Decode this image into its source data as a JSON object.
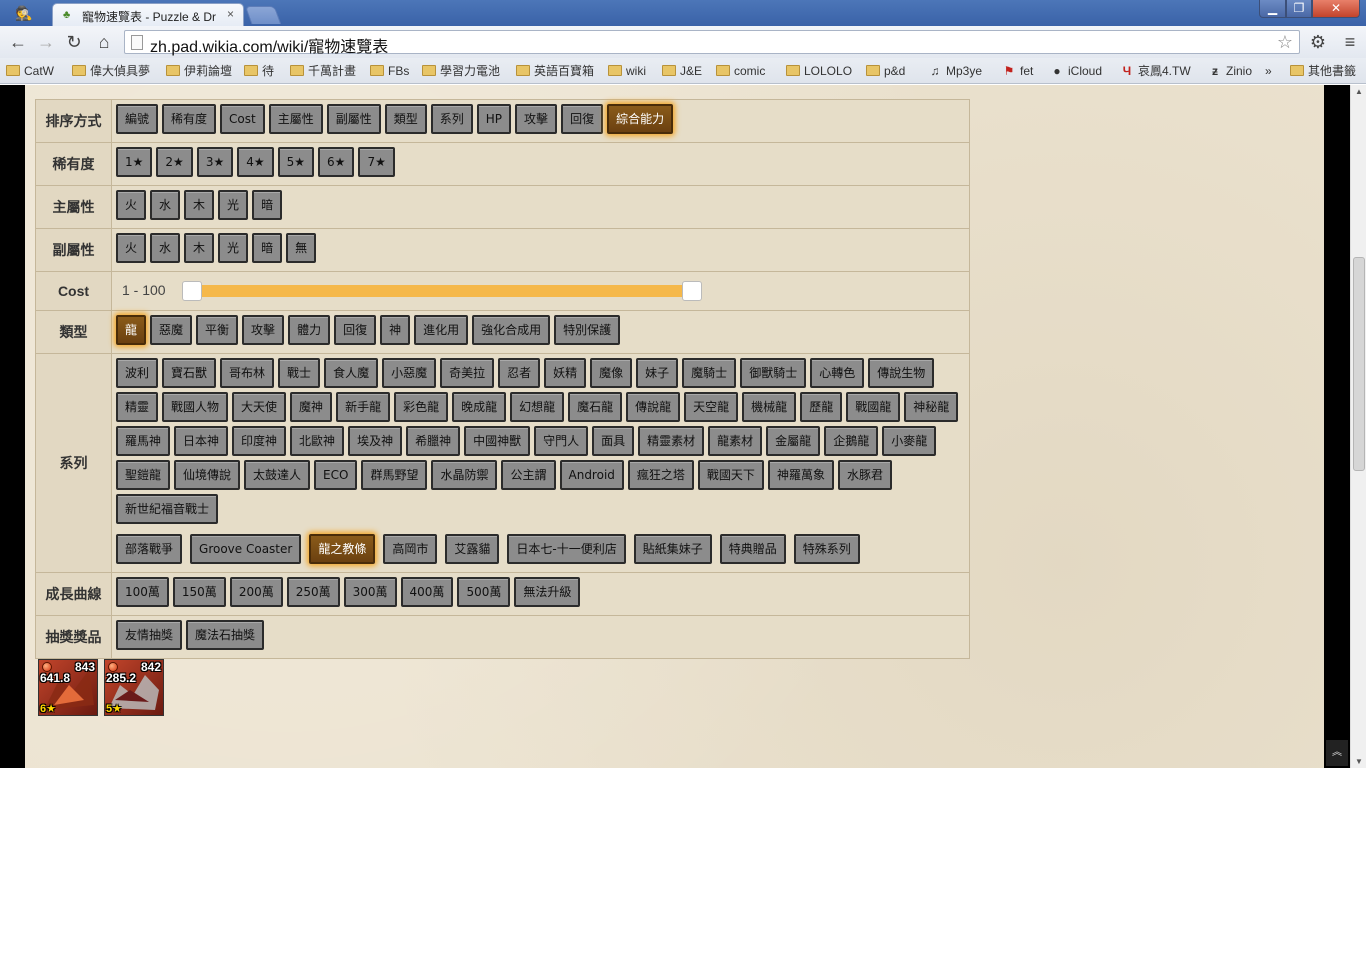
{
  "browser": {
    "tab_title": "寵物速覽表 - Puzzle & Dr",
    "tab_close": "×",
    "url_host": "zh.pad.wikia.com/wiki/寵物速覽表",
    "star": "☆"
  },
  "bookmarks": [
    {
      "label": "CatW",
      "icon": "folder-icon"
    },
    {
      "label": "偉大偵具夢",
      "icon": "folder-icon"
    },
    {
      "label": "伊莉論壇",
      "icon": "folder-icon"
    },
    {
      "label": "待",
      "icon": "folder-icon"
    },
    {
      "label": "千萬計畫",
      "icon": "folder-icon"
    },
    {
      "label": "FBs",
      "icon": "folder-icon"
    },
    {
      "label": "學習力電池",
      "icon": "folder-icon"
    },
    {
      "label": "英語百寶箱",
      "icon": "folder-icon"
    },
    {
      "label": "wiki",
      "icon": "folder-icon"
    },
    {
      "label": "J&E",
      "icon": "folder-icon"
    },
    {
      "label": "comic",
      "icon": "folder-icon"
    },
    {
      "label": "LOLOLO",
      "icon": "folder-icon"
    },
    {
      "label": "p&d",
      "icon": "folder-icon"
    },
    {
      "label": "Mp3ye",
      "icon": "music-icon"
    },
    {
      "label": "fet",
      "icon": "flag-icon"
    },
    {
      "label": "iCloud",
      "icon": "apple-icon"
    },
    {
      "label": "哀鳳4.TW",
      "icon": "logo-icon"
    },
    {
      "label": "Zinio",
      "icon": "zinio-icon"
    },
    {
      "label": "»",
      "icon": "more-icon"
    },
    {
      "label": "其他書籤",
      "icon": "folder-icon"
    }
  ],
  "filters": {
    "sort": {
      "label": "排序方式",
      "options": [
        "編號",
        "稀有度",
        "Cost",
        "主屬性",
        "副屬性",
        "類型",
        "系列",
        "HP",
        "攻擊",
        "回復",
        "綜合能力"
      ],
      "selected": "綜合能力"
    },
    "rarity": {
      "label": "稀有度",
      "options": [
        "1★",
        "2★",
        "3★",
        "4★",
        "5★",
        "6★",
        "7★"
      ]
    },
    "main_attr": {
      "label": "主屬性",
      "options": [
        "火",
        "水",
        "木",
        "光",
        "暗"
      ]
    },
    "sub_attr": {
      "label": "副屬性",
      "options": [
        "火",
        "水",
        "木",
        "光",
        "暗",
        "無"
      ]
    },
    "cost": {
      "label": "Cost",
      "range_text": "1 - 100",
      "min": 1,
      "max": 100
    },
    "type": {
      "label": "類型",
      "options": [
        "龍",
        "惡魔",
        "平衡",
        "攻擊",
        "體力",
        "回復",
        "神",
        "進化用",
        "強化合成用",
        "特別保護"
      ],
      "selected": "龍"
    },
    "series": {
      "label": "系列",
      "options": [
        "波利",
        "寶石獸",
        "哥布林",
        "戰士",
        "食人魔",
        "小惡魔",
        "奇美拉",
        "忍者",
        "妖精",
        "魔像",
        "妹子",
        "魔騎士",
        "御獸騎士",
        "心轉色",
        "傳說生物",
        "精靈",
        "戰國人物",
        "大天使",
        "魔神",
        "新手龍",
        "彩色龍",
        "晚成龍",
        "幻想龍",
        "魔石龍",
        "傳說龍",
        "天空龍",
        "機械龍",
        "歷龍",
        "戰國龍",
        "神秘龍",
        "羅馬神",
        "日本神",
        "印度神",
        "北歐神",
        "埃及神",
        "希臘神",
        "中國神獸",
        "守門人",
        "面具",
        "精靈素材",
        "龍素材",
        "金屬龍",
        "企鵝龍",
        "小麥龍",
        "聖鎧龍",
        "仙境傳說",
        "太鼓達人",
        "ECO",
        "群馬野望",
        "水晶防禦",
        "公主謂",
        "Android",
        "瘋狂之塔",
        "戰國天下",
        "神羅萬象",
        "水豚君",
        "新世紀福音戰士"
      ],
      "options2": [
        "部落戰爭",
        "Groove Coaster",
        "龍之教條",
        "高岡市",
        "艾露貓",
        "日本七-十一便利店",
        "貼紙集妹子",
        "特典贈品",
        "特殊系列"
      ],
      "selected": "龍之教條"
    },
    "growth": {
      "label": "成長曲線",
      "options": [
        "100萬",
        "150萬",
        "200萬",
        "250萬",
        "300萬",
        "400萬",
        "500萬",
        "無法升級"
      ]
    },
    "egg": {
      "label": "抽獎獎品",
      "options": [
        "友情抽獎",
        "魔法石抽獎"
      ]
    }
  },
  "cards": [
    {
      "number": "843",
      "stat": "641.8",
      "rarity": "6★",
      "attribute_color": "#d2300d"
    },
    {
      "number": "842",
      "stat": "285.2",
      "rarity": "5★",
      "attribute_color": "#d2300d"
    }
  ],
  "scroll_top_label": "︽"
}
